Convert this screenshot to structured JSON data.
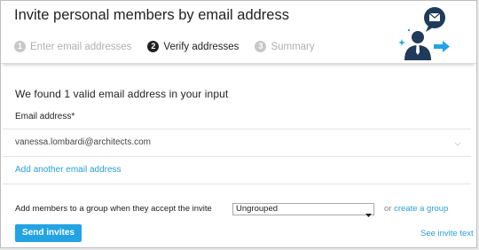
{
  "dialog": {
    "title": "Invite personal members by email address",
    "steps": [
      {
        "number": "1",
        "label": "Enter email addresses",
        "state": "inactive"
      },
      {
        "number": "2",
        "label": "Verify addresses",
        "state": "active"
      },
      {
        "number": "3",
        "label": "Summary",
        "state": "inactive"
      }
    ],
    "illustration_icon": "person-envelope-arrow-icon"
  },
  "main": {
    "found_message": "We found 1 valid email address in your input",
    "email_label": "Email address*",
    "emails": [
      "vanessa.lombardi@architects.com"
    ],
    "add_another": "Add another email address",
    "group_prompt": "Add members to a group when they accept the invite",
    "group_select_value": "Ungrouped",
    "or_text": "or",
    "create_group_link": "create a group"
  },
  "footer": {
    "send_button": "Send invites",
    "see_invite_link": "See invite text"
  },
  "colors": {
    "accent": "#23a3e2",
    "link": "#2a9fd8",
    "illustration_navy": "#1f3a5a"
  }
}
